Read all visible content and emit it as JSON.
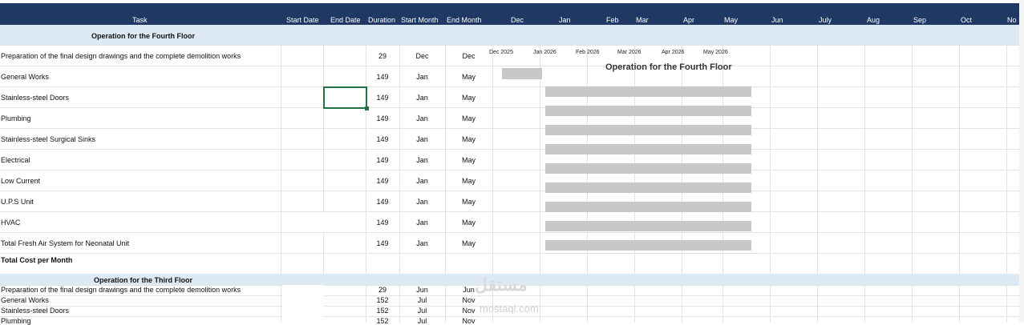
{
  "header": {
    "task": "Task",
    "start_date": "Start Date",
    "end_date": "End Date",
    "duration": "Duration",
    "start_month": "Start Month",
    "end_month": "End Month",
    "months": [
      "Dec",
      "Jan",
      "Feb",
      "Mar",
      "Apr",
      "May",
      "Jun",
      "July",
      "Aug",
      "Sep",
      "Oct",
      "No"
    ]
  },
  "fourth": {
    "title": "Operation for the Fourth Floor",
    "rows": [
      {
        "task": "Preparation of the final design drawings and the complete demolition works",
        "duration": "29",
        "start": "Dec",
        "end": "Dec"
      },
      {
        "task": "General Works",
        "duration": "149",
        "start": "Jan",
        "end": "May"
      },
      {
        "task": "Stainless-steel Doors",
        "duration": "149",
        "start": "Jan",
        "end": "May"
      },
      {
        "task": "Plumbing",
        "duration": "149",
        "start": "Jan",
        "end": "May"
      },
      {
        "task": "Stainless-steel Surgical Sinks",
        "duration": "149",
        "start": "Jan",
        "end": "May"
      },
      {
        "task": "Electrical",
        "duration": "149",
        "start": "Jan",
        "end": "May"
      },
      {
        "task": "Low Current",
        "duration": "149",
        "start": "Jan",
        "end": "May"
      },
      {
        "task": "U.P.S Unit",
        "duration": "149",
        "start": "Jan",
        "end": "May"
      },
      {
        "task": "HVAC",
        "duration": "149",
        "start": "Jan",
        "end": "May"
      },
      {
        "task": "Total Fresh Air System for Neonatal Unit",
        "duration": "149",
        "start": "Jan",
        "end": "May"
      }
    ],
    "total": "Total Cost per Month"
  },
  "chart": {
    "title": "Operation for the Fourth Floor",
    "axis": [
      "Dec 2025",
      "Jan 2026",
      "Feb 2026",
      "Mar 2026",
      "Apr 2026",
      "May 2026"
    ]
  },
  "third": {
    "title": "Operation for the Third Floor",
    "rows": [
      {
        "task": "Preparation of the final design drawings and the complete demolition works",
        "duration": "29",
        "start": "Jun",
        "end": "Jun"
      },
      {
        "task": "General Works",
        "duration": "152",
        "start": "Jul",
        "end": "Nov"
      },
      {
        "task": "Stainless-steel Doors",
        "duration": "152",
        "start": "Jul",
        "end": "Nov"
      },
      {
        "task": "Plumbing",
        "duration": "152",
        "start": "Jul",
        "end": "Nov"
      }
    ]
  },
  "watermark": {
    "arabic": "مستقل",
    "latin": "mostaql.com"
  },
  "colors": {
    "header_bg": "#1f3864",
    "section_bg": "#dde9f5",
    "bar": "#c8c8c8",
    "selection": "#217346"
  }
}
